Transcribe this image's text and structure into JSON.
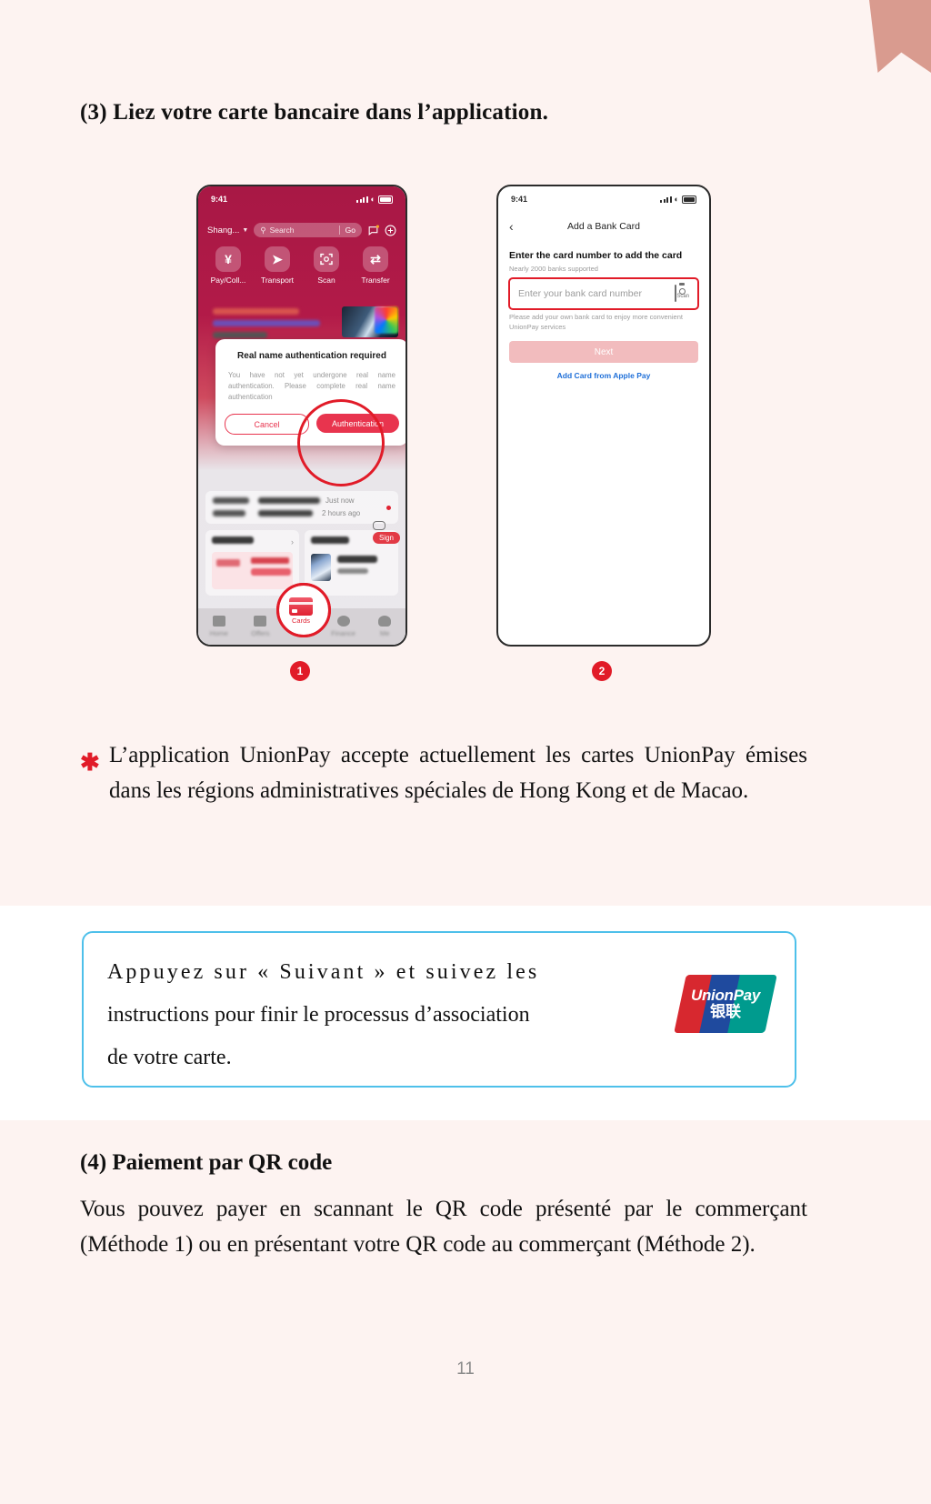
{
  "page": {
    "number": "11",
    "accent_red": "#e11b28",
    "callout_border": "#4ec0ea",
    "background": "#fdf3f1"
  },
  "section3": {
    "heading": "(3) Liez votre carte bancaire dans l’application.",
    "note_marker": "✱",
    "note": "L’application UnionPay accepte actuellement les cartes UnionPay émises dans les régions administratives spéciales de Hong Kong et de Macao."
  },
  "phone1": {
    "marker": "1",
    "status": {
      "time": "9:41",
      "signal_icon": "signal-bars-icon",
      "wifi_icon": "wifi-icon",
      "battery_icon": "battery-icon"
    },
    "header": {
      "city": "Shang...",
      "city_caret_icon": "chevron-down-icon",
      "search_placeholder": "Search",
      "search_icon": "search-icon",
      "go_label": "Go",
      "message_icon": "message-icon",
      "plus_icon": "plus-circle-icon"
    },
    "quick_actions": [
      {
        "label": "Pay/Coll...",
        "glyph": "¥",
        "icon": "pay-collect-icon"
      },
      {
        "label": "Transport",
        "glyph": "➤",
        "icon": "transport-icon"
      },
      {
        "label": "Scan",
        "glyph": "⬚",
        "icon": "scan-icon"
      },
      {
        "label": "Transfer",
        "glyph": "⇄",
        "icon": "transfer-icon"
      }
    ],
    "feed": {
      "item1_time": "Just now",
      "item2_time": "2 hours ago",
      "sign_label": "Sign"
    },
    "tabs": [
      {
        "label": "Home",
        "icon": "home-icon"
      },
      {
        "label": "Offers",
        "icon": "offers-icon"
      },
      {
        "label": "Cards",
        "icon": "cards-icon"
      },
      {
        "label": "Finance",
        "icon": "finance-icon"
      },
      {
        "label": "Me",
        "icon": "person-icon"
      }
    ],
    "highlighted_tab": "Cards",
    "modal": {
      "title": "Real name authentication required",
      "body": "You have not yet undergone real name authentication. Please complete real name authentication",
      "cancel_label": "Cancel",
      "confirm_label": "Authentication"
    }
  },
  "phone2": {
    "marker": "2",
    "status": {
      "time": "9:41",
      "signal_icon": "signal-bars-icon",
      "wifi_icon": "wifi-icon",
      "battery_icon": "battery-icon"
    },
    "nav": {
      "back_icon": "chevron-left-icon",
      "title": "Add a Bank Card"
    },
    "form": {
      "heading": "Enter the card number to add the card",
      "subheading": "Nearly 2000 banks supported",
      "input_placeholder": "Enter your bank card number",
      "scan_icon": "camera-scan-icon",
      "scan_label": "Scan",
      "note": "Please add your own bank card to enjoy more convenient UnionPay services",
      "next_label": "Next",
      "apple_pay_link": "Add Card from Apple Pay"
    }
  },
  "callout": {
    "line1": "Appuyez sur « Suivant » et suivez les",
    "line2": "instructions pour finir le processus d’association",
    "line3": "de votre carte.",
    "logo": {
      "name": "unionpay-logo",
      "english": "UnionPay",
      "chinese": "银联"
    }
  },
  "section4": {
    "heading": "(4) Paiement par QR code",
    "body": "Vous pouvez payer en scannant le QR code présenté par le commerçant (Méthode 1) ou en présentant votre QR code au commerçant (Méthode 2)."
  }
}
